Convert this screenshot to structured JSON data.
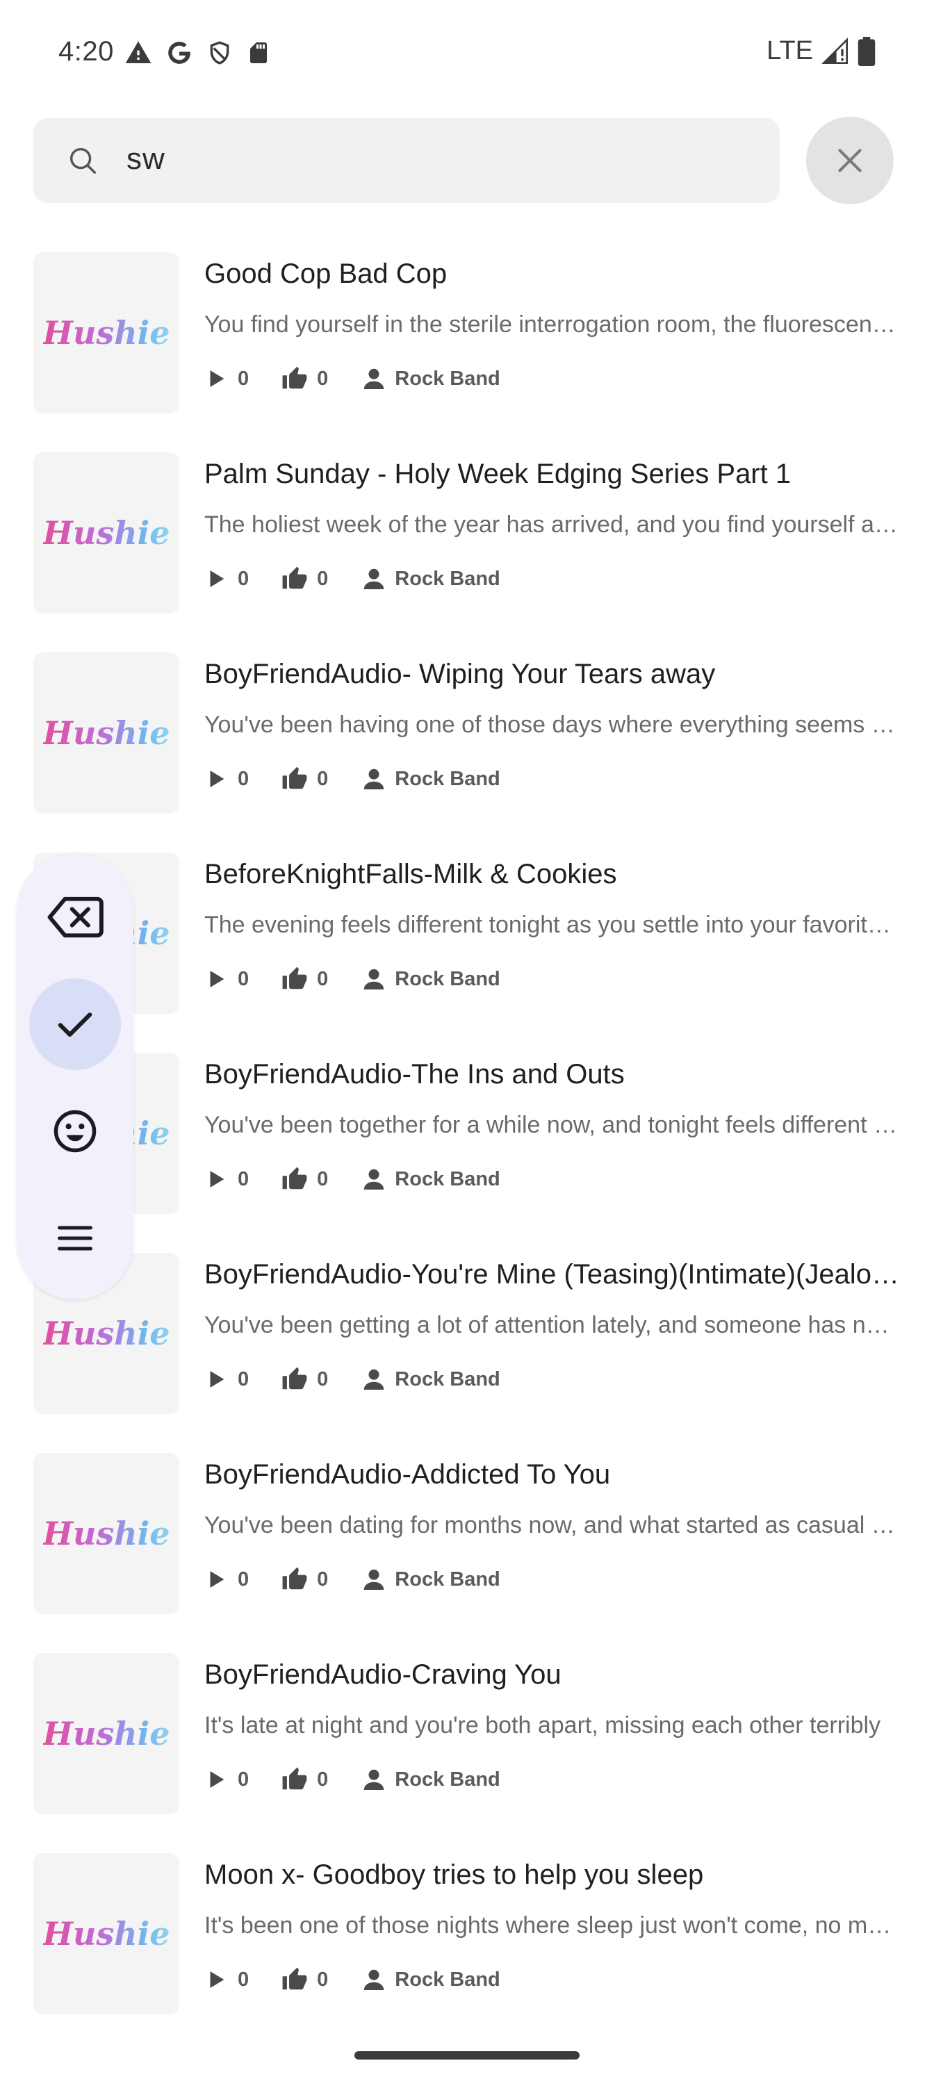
{
  "status_bar": {
    "time": "4:20",
    "network": "LTE",
    "left_icons": [
      "warning-icon",
      "google-icon",
      "shield-icon",
      "sd-card-icon"
    ],
    "right_icons": [
      "signal-icon",
      "battery-icon"
    ]
  },
  "search": {
    "query": "sw"
  },
  "logo_text": "Hushie",
  "items": [
    {
      "title": "Good Cop Bad Cop",
      "description": "You find yourself in the sterile interrogation room, the fluorescent lights humming overhead",
      "plays": "0",
      "likes": "0",
      "author": "Rock Band"
    },
    {
      "title": "Palm Sunday - Holy Week Edging Series Part 1",
      "description": "The holiest week of the year has arrived, and you find yourself alone with him",
      "plays": "0",
      "likes": "0",
      "author": "Rock Band"
    },
    {
      "title": "BoyFriendAudio- Wiping Your Tears away",
      "description": "You've been having one of those days where everything seems to go wrong",
      "plays": "0",
      "likes": "0",
      "author": "Rock Band"
    },
    {
      "title": "BeforeKnightFalls-Milk & Cookies",
      "description": "The evening feels different tonight as you settle into your favorite spot",
      "plays": "0",
      "likes": "0",
      "author": "Rock Band"
    },
    {
      "title": "BoyFriendAudio-The Ins and Outs",
      "description": "You've been together for a while now, and tonight feels different somehow",
      "plays": "0",
      "likes": "0",
      "author": "Rock Band"
    },
    {
      "title": "BoyFriendAudio-You're Mine (Teasing)(Intimate)(Jealous)",
      "description": "You've been getting a lot of attention lately, and someone has noticed",
      "plays": "0",
      "likes": "0",
      "author": "Rock Band"
    },
    {
      "title": "BoyFriendAudio-Addicted To You",
      "description": "You've been dating for months now, and what started as casual has become",
      "plays": "0",
      "likes": "0",
      "author": "Rock Band"
    },
    {
      "title": "BoyFriendAudio-Craving You",
      "description": "It's late at night and you're both apart, missing each other terribly",
      "plays": "0",
      "likes": "0",
      "author": "Rock Band"
    },
    {
      "title": "Moon x- Goodboy tries to help you sleep",
      "description": "It's been one of those nights where sleep just won't come, no matter what",
      "plays": "0",
      "likes": "0",
      "author": "Rock Band"
    }
  ],
  "rail": {
    "buttons": [
      "backspace-icon",
      "check-icon",
      "emoji-icon",
      "menu-icon"
    ],
    "active_index": 1
  }
}
